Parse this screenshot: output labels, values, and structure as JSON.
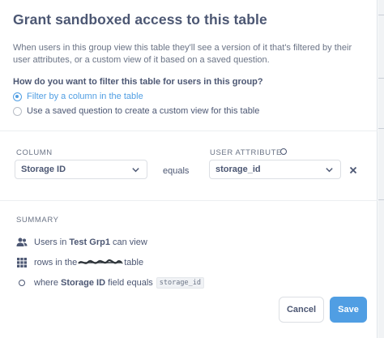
{
  "dialog": {
    "title": "Grant sandboxed access to this table",
    "description": "When users in this group view this table they'll see a version of it that's filtered by their user attributes, or a custom view of it based on a saved question.",
    "question": "How do you want to filter this table for users in this group?",
    "options": [
      {
        "label": "Filter by a column in the table",
        "selected": true
      },
      {
        "label": "Use a saved question to create a custom view for this table",
        "selected": false
      }
    ]
  },
  "mapping": {
    "column_caption": "COLUMN",
    "attribute_caption": "USER ATTRIBUTE",
    "column_value": "Storage ID",
    "operator": "equals",
    "attribute_value": "storage_id"
  },
  "summary": {
    "caption": "SUMMARY",
    "line1_prefix": "Users in",
    "line1_group": "Test Grp1",
    "line1_suffix": "can view",
    "line2_prefix": "rows in the",
    "line2_suffix": "table",
    "line3_prefix": "where",
    "line3_column": "Storage ID",
    "line3_mid": "field equals",
    "line3_code": "storage_id"
  },
  "buttons": {
    "cancel": "Cancel",
    "save": "Save"
  },
  "colors": {
    "accent": "#509ee3",
    "text": "#4c5773"
  },
  "icons": [
    "users-icon",
    "table-grid-icon",
    "circle-icon",
    "chevron-down-icon",
    "close-icon"
  ]
}
